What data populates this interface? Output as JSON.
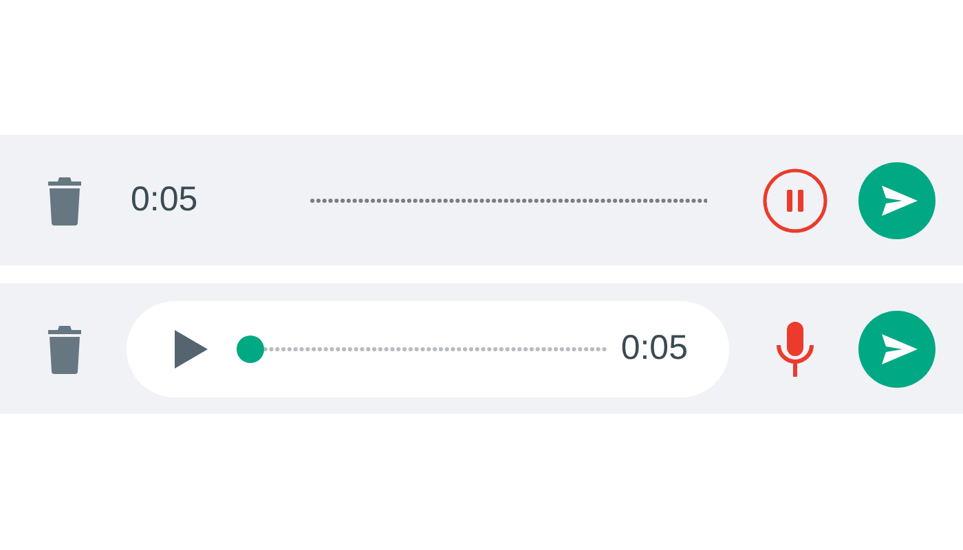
{
  "rows": [
    {
      "kind": "recording",
      "time": "0:05"
    },
    {
      "kind": "playback",
      "time": "0:05"
    }
  ]
}
